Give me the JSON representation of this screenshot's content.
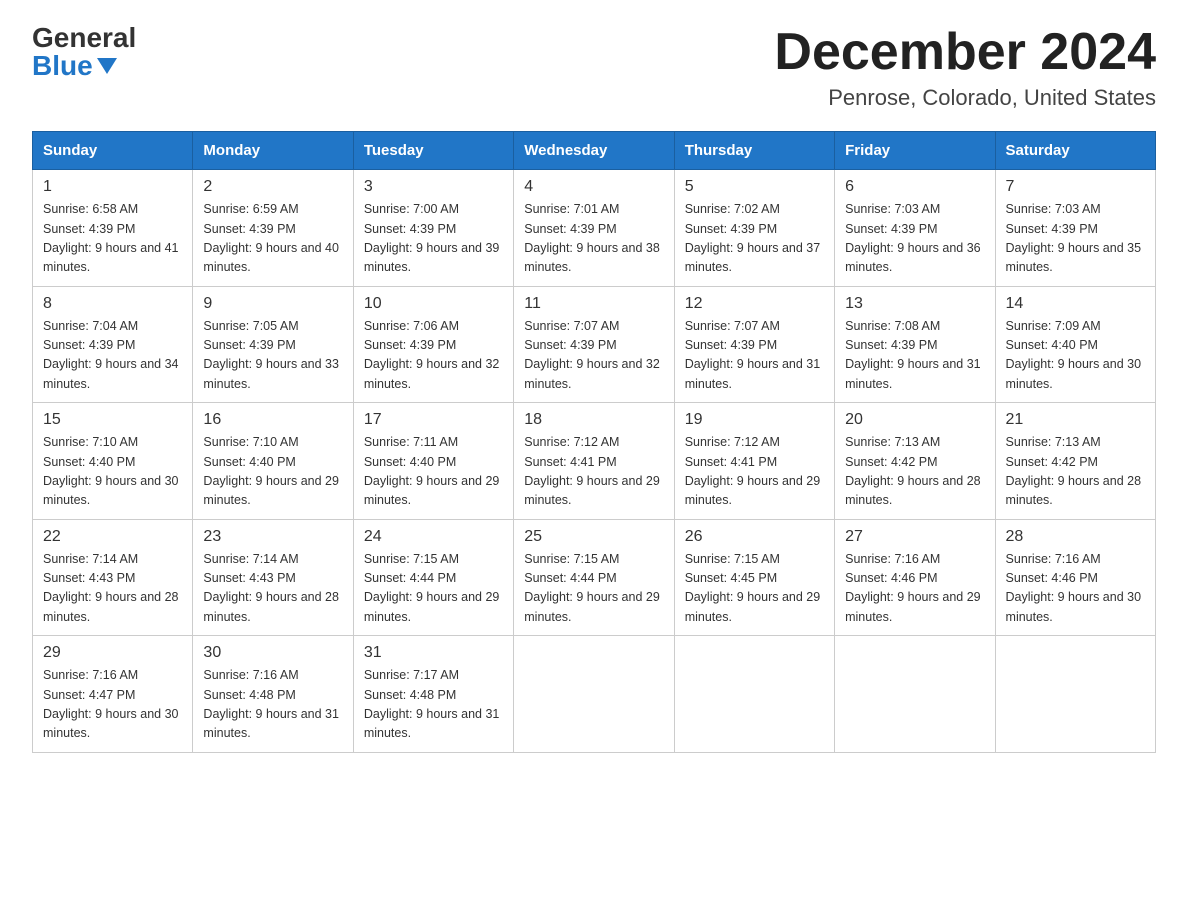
{
  "header": {
    "logo_general": "General",
    "logo_blue": "Blue",
    "month_title": "December 2024",
    "location": "Penrose, Colorado, United States"
  },
  "days_of_week": [
    "Sunday",
    "Monday",
    "Tuesday",
    "Wednesday",
    "Thursday",
    "Friday",
    "Saturday"
  ],
  "weeks": [
    [
      {
        "day": "1",
        "sunrise": "6:58 AM",
        "sunset": "4:39 PM",
        "daylight": "9 hours and 41 minutes."
      },
      {
        "day": "2",
        "sunrise": "6:59 AM",
        "sunset": "4:39 PM",
        "daylight": "9 hours and 40 minutes."
      },
      {
        "day": "3",
        "sunrise": "7:00 AM",
        "sunset": "4:39 PM",
        "daylight": "9 hours and 39 minutes."
      },
      {
        "day": "4",
        "sunrise": "7:01 AM",
        "sunset": "4:39 PM",
        "daylight": "9 hours and 38 minutes."
      },
      {
        "day": "5",
        "sunrise": "7:02 AM",
        "sunset": "4:39 PM",
        "daylight": "9 hours and 37 minutes."
      },
      {
        "day": "6",
        "sunrise": "7:03 AM",
        "sunset": "4:39 PM",
        "daylight": "9 hours and 36 minutes."
      },
      {
        "day": "7",
        "sunrise": "7:03 AM",
        "sunset": "4:39 PM",
        "daylight": "9 hours and 35 minutes."
      }
    ],
    [
      {
        "day": "8",
        "sunrise": "7:04 AM",
        "sunset": "4:39 PM",
        "daylight": "9 hours and 34 minutes."
      },
      {
        "day": "9",
        "sunrise": "7:05 AM",
        "sunset": "4:39 PM",
        "daylight": "9 hours and 33 minutes."
      },
      {
        "day": "10",
        "sunrise": "7:06 AM",
        "sunset": "4:39 PM",
        "daylight": "9 hours and 32 minutes."
      },
      {
        "day": "11",
        "sunrise": "7:07 AM",
        "sunset": "4:39 PM",
        "daylight": "9 hours and 32 minutes."
      },
      {
        "day": "12",
        "sunrise": "7:07 AM",
        "sunset": "4:39 PM",
        "daylight": "9 hours and 31 minutes."
      },
      {
        "day": "13",
        "sunrise": "7:08 AM",
        "sunset": "4:39 PM",
        "daylight": "9 hours and 31 minutes."
      },
      {
        "day": "14",
        "sunrise": "7:09 AM",
        "sunset": "4:40 PM",
        "daylight": "9 hours and 30 minutes."
      }
    ],
    [
      {
        "day": "15",
        "sunrise": "7:10 AM",
        "sunset": "4:40 PM",
        "daylight": "9 hours and 30 minutes."
      },
      {
        "day": "16",
        "sunrise": "7:10 AM",
        "sunset": "4:40 PM",
        "daylight": "9 hours and 29 minutes."
      },
      {
        "day": "17",
        "sunrise": "7:11 AM",
        "sunset": "4:40 PM",
        "daylight": "9 hours and 29 minutes."
      },
      {
        "day": "18",
        "sunrise": "7:12 AM",
        "sunset": "4:41 PM",
        "daylight": "9 hours and 29 minutes."
      },
      {
        "day": "19",
        "sunrise": "7:12 AM",
        "sunset": "4:41 PM",
        "daylight": "9 hours and 29 minutes."
      },
      {
        "day": "20",
        "sunrise": "7:13 AM",
        "sunset": "4:42 PM",
        "daylight": "9 hours and 28 minutes."
      },
      {
        "day": "21",
        "sunrise": "7:13 AM",
        "sunset": "4:42 PM",
        "daylight": "9 hours and 28 minutes."
      }
    ],
    [
      {
        "day": "22",
        "sunrise": "7:14 AM",
        "sunset": "4:43 PM",
        "daylight": "9 hours and 28 minutes."
      },
      {
        "day": "23",
        "sunrise": "7:14 AM",
        "sunset": "4:43 PM",
        "daylight": "9 hours and 28 minutes."
      },
      {
        "day": "24",
        "sunrise": "7:15 AM",
        "sunset": "4:44 PM",
        "daylight": "9 hours and 29 minutes."
      },
      {
        "day": "25",
        "sunrise": "7:15 AM",
        "sunset": "4:44 PM",
        "daylight": "9 hours and 29 minutes."
      },
      {
        "day": "26",
        "sunrise": "7:15 AM",
        "sunset": "4:45 PM",
        "daylight": "9 hours and 29 minutes."
      },
      {
        "day": "27",
        "sunrise": "7:16 AM",
        "sunset": "4:46 PM",
        "daylight": "9 hours and 29 minutes."
      },
      {
        "day": "28",
        "sunrise": "7:16 AM",
        "sunset": "4:46 PM",
        "daylight": "9 hours and 30 minutes."
      }
    ],
    [
      {
        "day": "29",
        "sunrise": "7:16 AM",
        "sunset": "4:47 PM",
        "daylight": "9 hours and 30 minutes."
      },
      {
        "day": "30",
        "sunrise": "7:16 AM",
        "sunset": "4:48 PM",
        "daylight": "9 hours and 31 minutes."
      },
      {
        "day": "31",
        "sunrise": "7:17 AM",
        "sunset": "4:48 PM",
        "daylight": "9 hours and 31 minutes."
      },
      null,
      null,
      null,
      null
    ]
  ]
}
